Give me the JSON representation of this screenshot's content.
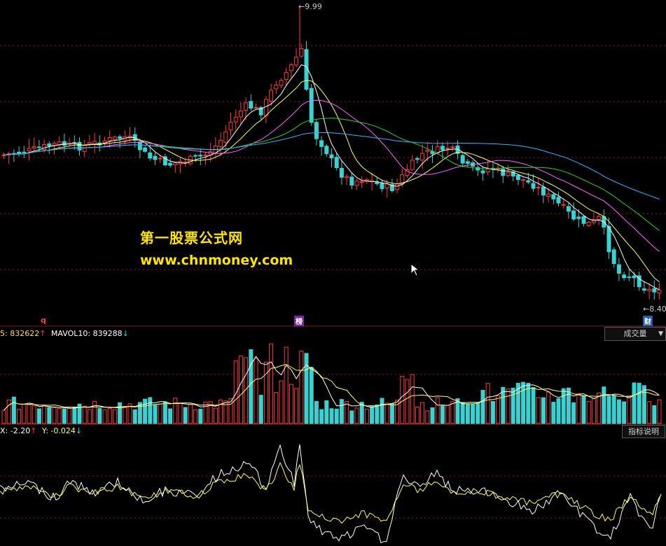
{
  "price_panel": {
    "high_label": "9.99",
    "low_label": "8.40",
    "markers": [
      "q",
      "榜",
      "财"
    ]
  },
  "watermark": {
    "line1": "第一股票公式网",
    "line2": "www.chnmoney.com"
  },
  "volume_panel": {
    "ma5_prefix": "5:",
    "ma5_value": "832622",
    "ma5_arrow": "↑",
    "ma10_label": "MAVOL10:",
    "ma10_value": "839288",
    "ma10_arrow": "↓",
    "selector_label": "成交量",
    "selector_arrow": "▼"
  },
  "indicator_panel": {
    "x_prefix": "X:",
    "x_value": "-2.20",
    "x_arrow": "↑",
    "y_label": "Y:",
    "y_value": "-0.024",
    "y_arrow": "↓",
    "help_button": "指标说明"
  },
  "colors": {
    "up": "#ff3b3b",
    "down": "#3bd1d1",
    "grid": "#8a1a1a",
    "ma5": "#ffffff",
    "ma10": "#ffff66",
    "ma20": "#ff66ff",
    "ma30": "#33cc33",
    "ma60": "#33b5ff"
  },
  "chart_data": {
    "type": "candlestick",
    "y_range_visible": [
      8.4,
      9.99
    ],
    "high": 9.99,
    "low": 8.4,
    "moving_averages": [
      "MA5",
      "MA10",
      "MA20",
      "MA30",
      "MA60"
    ],
    "volume_ma": {
      "MAVOL5": 832622,
      "MAVOL10": 839288
    },
    "indicator": {
      "X": -2.2,
      "Y": -0.024
    }
  }
}
